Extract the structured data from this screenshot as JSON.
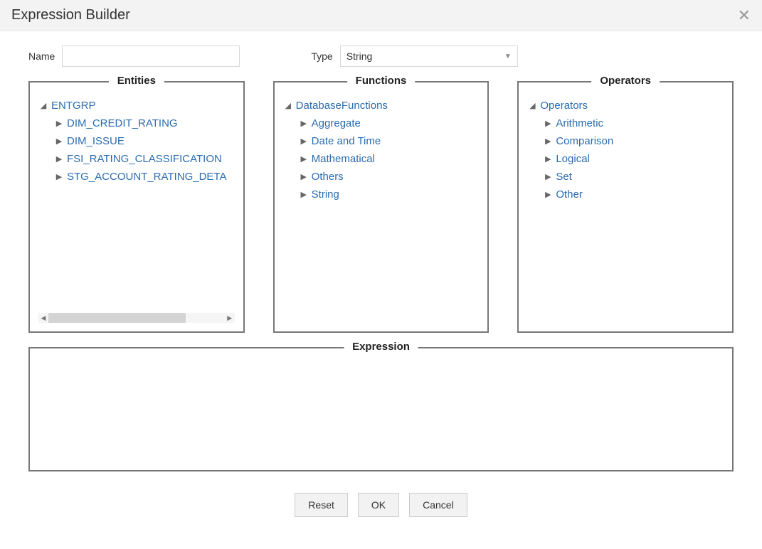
{
  "header": {
    "title": "Expression Builder"
  },
  "form": {
    "name_label": "Name",
    "name_value": "",
    "type_label": "Type",
    "type_value": "String"
  },
  "panels": {
    "entities": {
      "legend": "Entities",
      "root": "ENTGRP",
      "children": [
        "DIM_CREDIT_RATING",
        "DIM_ISSUE",
        "FSI_RATING_CLASSIFICATION",
        "STG_ACCOUNT_RATING_DETA"
      ]
    },
    "functions": {
      "legend": "Functions",
      "root": "DatabaseFunctions",
      "children": [
        "Aggregate",
        "Date and Time",
        "Mathematical",
        "Others",
        "String"
      ]
    },
    "operators": {
      "legend": "Operators",
      "root": "Operators",
      "children": [
        "Arithmetic",
        "Comparison",
        "Logical",
        "Set",
        "Other"
      ]
    }
  },
  "expression": {
    "legend": "Expression",
    "value": ""
  },
  "buttons": {
    "reset": "Reset",
    "ok": "OK",
    "cancel": "Cancel"
  }
}
